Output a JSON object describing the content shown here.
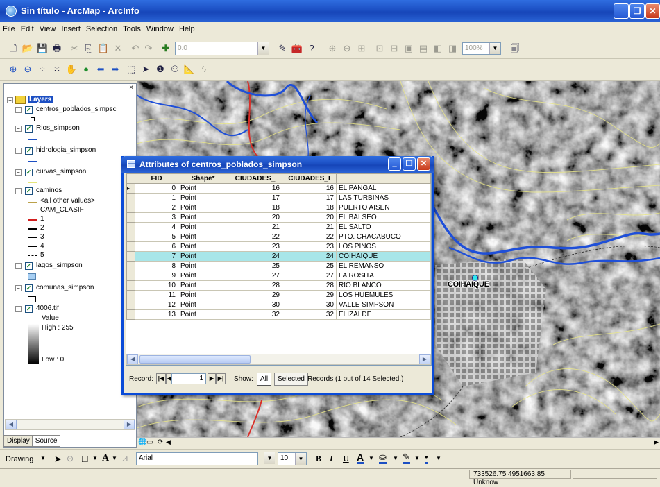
{
  "window": {
    "title": "Sin título - ArcMap - ArcInfo"
  },
  "menu": [
    "File",
    "Edit",
    "View",
    "Insert",
    "Selection",
    "Tools",
    "Window",
    "Help"
  ],
  "toolbar": {
    "scale_value": "0.0",
    "zoom_percent": "100%"
  },
  "toc": {
    "root_label": "Layers",
    "layers": [
      {
        "name": "centros_poblados_simpsc",
        "checked": true
      },
      {
        "name": "Rios_simpson",
        "checked": true
      },
      {
        "name": "hidrologia_simpson",
        "checked": true
      },
      {
        "name": "curvas_simpson",
        "checked": true
      },
      {
        "name": "caminos",
        "checked": true,
        "legend_heading": "CAM_CLASIF",
        "other_values": "<all other values>",
        "classes": [
          "1",
          "2",
          "3",
          "4",
          "5"
        ]
      },
      {
        "name": "lagos_simpson",
        "checked": true
      },
      {
        "name": "comunas_simpson",
        "checked": true
      },
      {
        "name": "4006.tif",
        "checked": true,
        "value_label": "Value",
        "high": "High : 255",
        "low": "Low : 0"
      }
    ],
    "tabs": [
      "Display",
      "Source"
    ]
  },
  "attributes": {
    "title": "Attributes of centros_poblados_simpson",
    "columns": [
      "FID",
      "Shape*",
      "CIUDADES_",
      "CIUDADES_I",
      ""
    ],
    "rows": [
      [
        "0",
        "Point",
        "16",
        "16",
        "EL PANGAL"
      ],
      [
        "1",
        "Point",
        "17",
        "17",
        "LAS TURBINAS"
      ],
      [
        "2",
        "Point",
        "18",
        "18",
        "PUERTO AISEN"
      ],
      [
        "3",
        "Point",
        "20",
        "20",
        "EL BALSEO"
      ],
      [
        "4",
        "Point",
        "21",
        "21",
        "EL SALTO"
      ],
      [
        "5",
        "Point",
        "22",
        "22",
        "PTO. CHACABUCO"
      ],
      [
        "6",
        "Point",
        "23",
        "23",
        "LOS PINOS"
      ],
      [
        "7",
        "Point",
        "24",
        "24",
        "COIHAIQUE"
      ],
      [
        "8",
        "Point",
        "25",
        "25",
        "EL REMANSO"
      ],
      [
        "9",
        "Point",
        "27",
        "27",
        "LA ROSITA"
      ],
      [
        "10",
        "Point",
        "28",
        "28",
        "RIO BLANCO"
      ],
      [
        "11",
        "Point",
        "29",
        "29",
        "LOS HUEMULES"
      ],
      [
        "12",
        "Point",
        "30",
        "30",
        "VALLE SIMPSON"
      ],
      [
        "13",
        "Point",
        "32",
        "32",
        "ELIZALDE"
      ]
    ],
    "selected_index": 7,
    "record_label": "Record:",
    "record_value": "1",
    "show_label": "Show:",
    "show_all": "All",
    "show_selected": "Selected",
    "records_status": "Records (1 out of 14 Selected.)"
  },
  "map": {
    "label": "COIHAIQUE"
  },
  "drawing": {
    "drawing_label": "Drawing",
    "font_name": "Arial",
    "font_size": "10",
    "bold": "B",
    "italic": "I",
    "underline": "U"
  },
  "status": {
    "coordinates": "733526.75  4951663.85 Unknow"
  }
}
